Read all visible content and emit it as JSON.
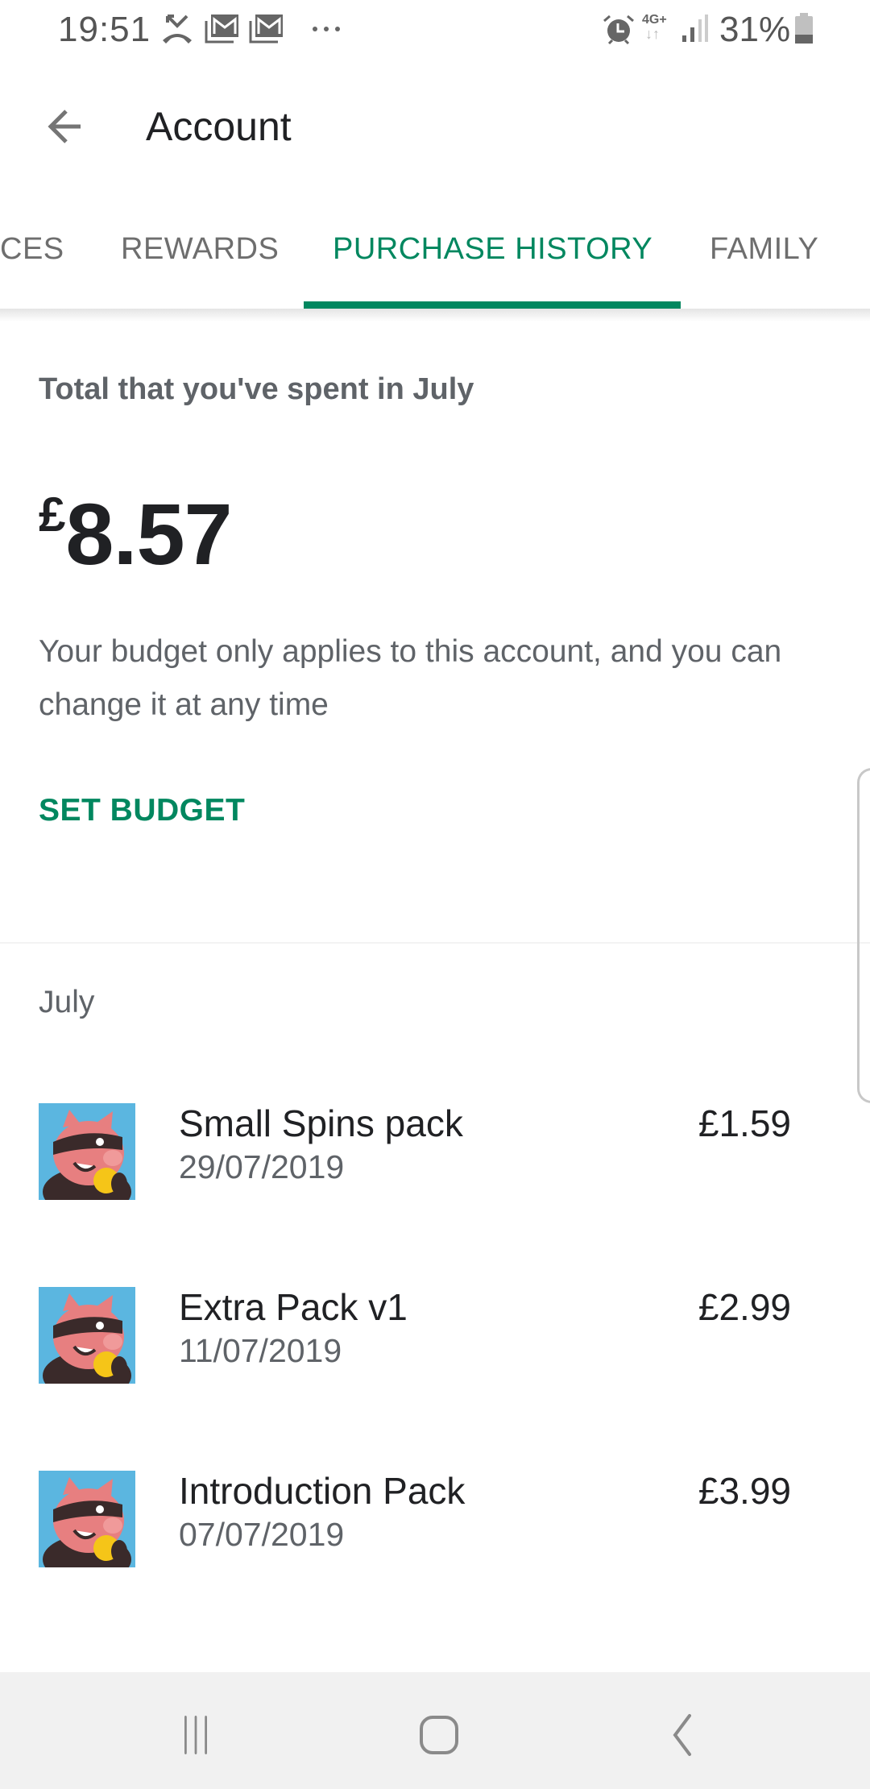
{
  "status_bar": {
    "time": "19:51",
    "left_icons": [
      "missed-call-icon",
      "gmail-icon",
      "gmail-icon",
      "more-notifications-icon"
    ],
    "right_icons": [
      "alarm-icon",
      "network-4g-plus-icon",
      "signal-icon",
      "battery-icon"
    ],
    "network_label": "4G+",
    "battery_percent": "31%",
    "battery_level": 0.31
  },
  "app_bar": {
    "title": "Account",
    "back_icon": "arrow-back-icon"
  },
  "tabs": {
    "items": [
      {
        "label": "CES"
      },
      {
        "label": "REWARDS"
      },
      {
        "label": "PURCHASE HISTORY"
      },
      {
        "label": "FAMILY"
      }
    ],
    "active_index": 2
  },
  "summary": {
    "total_label": "Total that you've spent in July",
    "currency_symbol": "£",
    "amount": "8.57",
    "description": "Your budget only applies to this account, and you can change it at any time",
    "set_budget_label": "SET BUDGET"
  },
  "history": {
    "month": "July",
    "items": [
      {
        "title": "Small Spins pack",
        "date": "29/07/2019",
        "price": "£1.59",
        "icon": "coin-master-pig-icon"
      },
      {
        "title": "Extra Pack v1",
        "date": "11/07/2019",
        "price": "£2.99",
        "icon": "coin-master-pig-icon"
      },
      {
        "title": "Introduction Pack",
        "date": "07/07/2019",
        "price": "£3.99",
        "icon": "coin-master-pig-icon"
      }
    ]
  },
  "nav_bar": {
    "buttons": [
      "recent-apps-icon",
      "home-icon",
      "back-icon"
    ]
  },
  "colors": {
    "accent": "#01875f",
    "text_primary": "#202124",
    "text_secondary": "#5f6368",
    "nav_bg": "#f1f1f1"
  }
}
